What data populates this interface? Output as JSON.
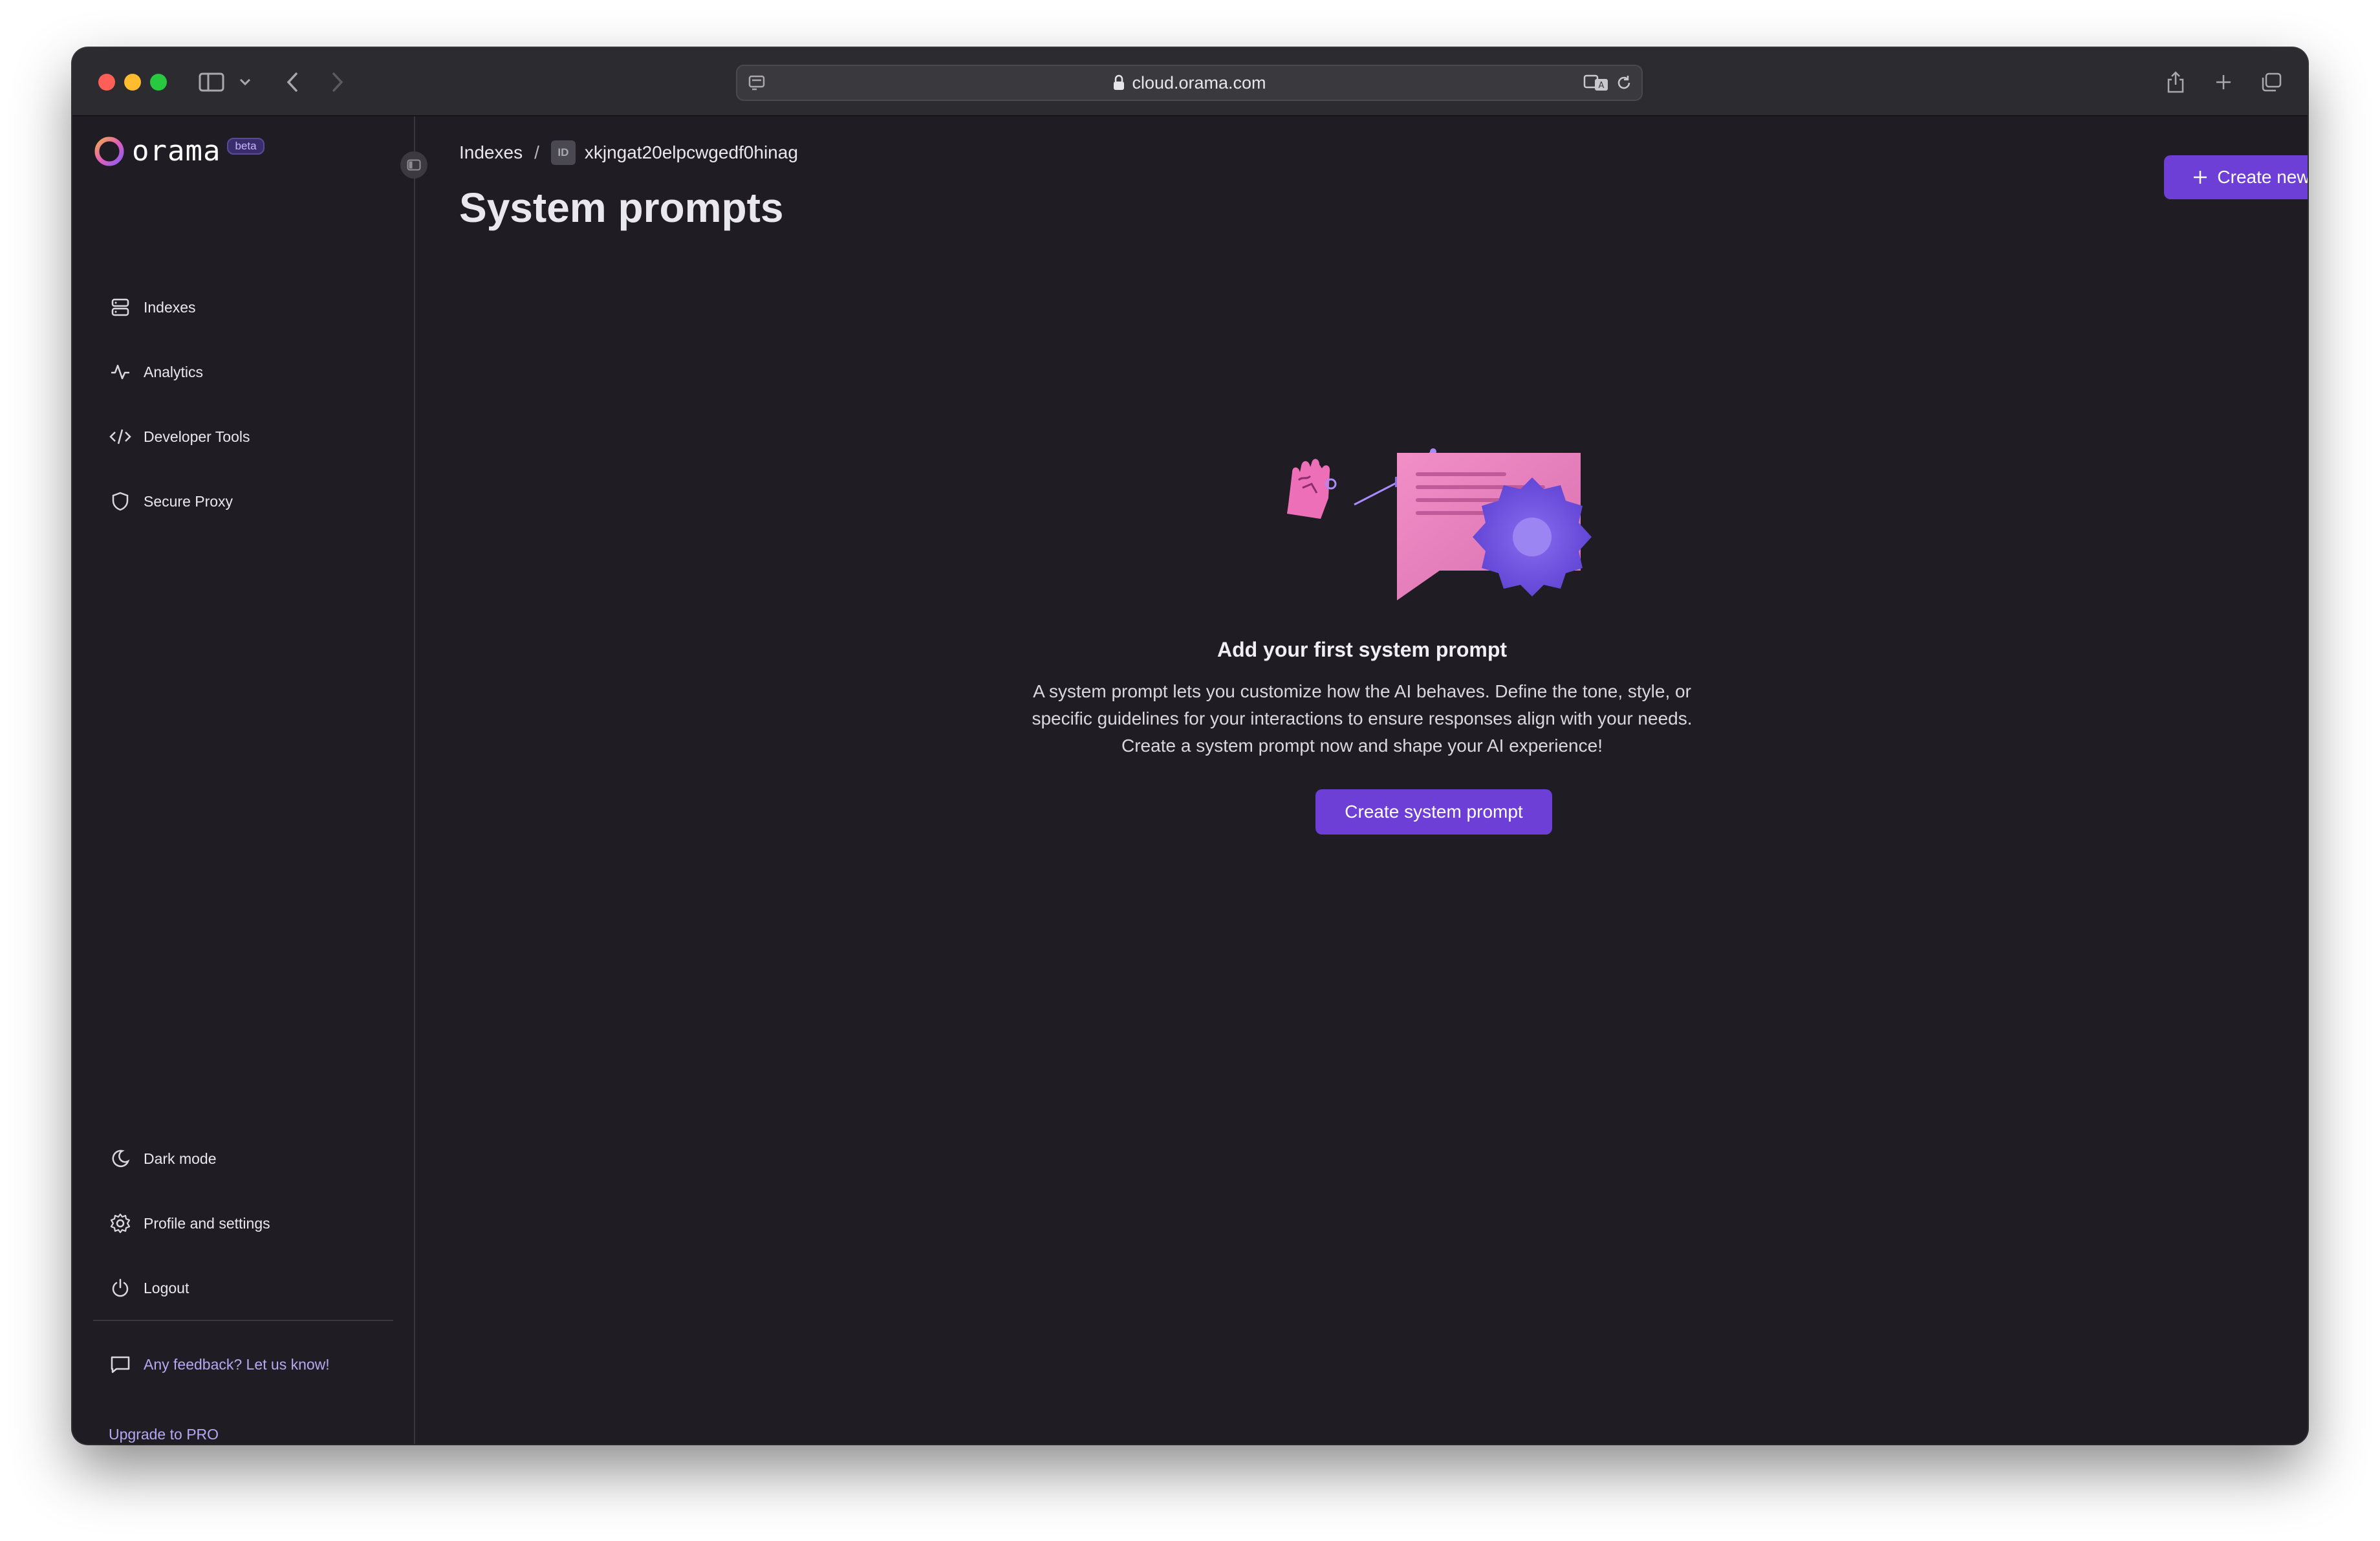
{
  "browser": {
    "url": "cloud.orama.com"
  },
  "app": {
    "logo_text": "orama",
    "beta_label": "beta",
    "accent_color": "#6d3fd6"
  },
  "sidebar": {
    "items": [
      {
        "label": "Indexes",
        "icon": "server-icon"
      },
      {
        "label": "Analytics",
        "icon": "activity-icon"
      },
      {
        "label": "Developer Tools",
        "icon": "code-icon"
      },
      {
        "label": "Secure Proxy",
        "icon": "shield-icon"
      }
    ],
    "bottom_items": [
      {
        "label": "Dark mode",
        "icon": "moon-icon"
      },
      {
        "label": "Profile and settings",
        "icon": "gear-icon"
      },
      {
        "label": "Logout",
        "icon": "power-icon"
      }
    ],
    "feedback_label": "Any feedback? Let us know!",
    "upgrade_label": "Upgrade to PRO"
  },
  "main": {
    "breadcrumb": {
      "root": "Indexes",
      "separator": "/",
      "id_badge": "ID",
      "index_id": "xkjngat20elpcwgedf0hinag"
    },
    "title": "System prompts",
    "create_new_label": "Create new",
    "empty_state": {
      "title": "Add your first system prompt",
      "description_lines": [
        "A system prompt lets you customize how the AI behaves. Define the tone, style, or",
        "specific guidelines for your interactions to ensure responses align with your needs.",
        "Create a system prompt now and shape your AI experience!"
      ],
      "button_label": "Create system prompt"
    }
  }
}
